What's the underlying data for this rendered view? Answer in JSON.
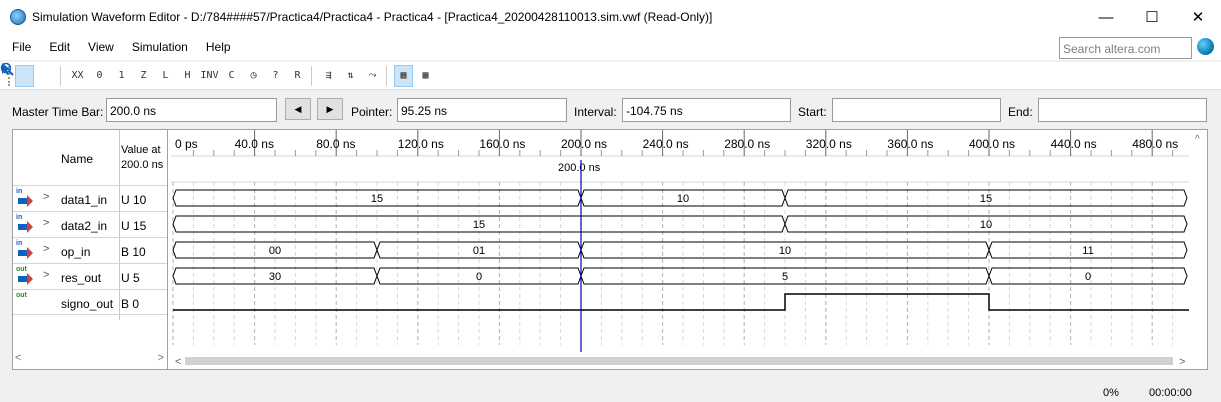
{
  "window": {
    "title": "Simulation Waveform Editor - D:/784####57/Practica4/Practica4 - Practica4 - [Practica4_20200428110013.sim.vwf (Read-Only)]",
    "minimize": "—",
    "maximize": "☐",
    "close": "✕"
  },
  "menu": [
    "File",
    "Edit",
    "View",
    "Simulation",
    "Help"
  ],
  "search": {
    "placeholder": "Search altera.com"
  },
  "toolbar": {
    "icons": [
      "selection-tool",
      "zoom-tool",
      "forcing-unknown",
      "forcing-low",
      "forcing-high",
      "high-impedance",
      "weak-low",
      "weak-high",
      "invert",
      "count-value",
      "clock",
      "arbitrary-value",
      "random-values",
      "snap-to-grid",
      "sort",
      "group",
      "overwrite-clock",
      "grid-display",
      "time-bar"
    ]
  },
  "timebar": {
    "master_label": "Master Time Bar:",
    "master_value": "200.0 ns",
    "prev": "◀",
    "next": "▶",
    "pointer_label": "Pointer:",
    "pointer_value": "95.25 ns",
    "interval_label": "Interval:",
    "interval_value": "-104.75 ns",
    "start_label": "Start:",
    "start_value": "",
    "end_label": "End:",
    "end_value": ""
  },
  "signals_header": {
    "name": "Name",
    "value_line1": "Value at",
    "value_line2": "200.0 ns"
  },
  "time_axis": {
    "labels": [
      "0 ps",
      "40.0 ns",
      "80.0 ns",
      "120.0 ns",
      "160.0 ns",
      "200.0 ns",
      "240.0 ns",
      "280.0 ns",
      "320.0 ns",
      "360.0 ns",
      "400.0 ns",
      "440.0 ns",
      "480.0 ns"
    ],
    "cursor_label": "200.0 ns",
    "cursor_time": 200
  },
  "signals": [
    {
      "name": "data1_in",
      "dir": "in",
      "value": "U 10",
      "type": "bus",
      "segments": [
        {
          "start": 0,
          "end": 200,
          "label": "15"
        },
        {
          "start": 200,
          "end": 300,
          "label": "10"
        },
        {
          "start": 300,
          "end": 500,
          "label": "15"
        }
      ]
    },
    {
      "name": "data2_in",
      "dir": "in",
      "value": "U 15",
      "type": "bus",
      "segments": [
        {
          "start": 0,
          "end": 300,
          "label": "15"
        },
        {
          "start": 300,
          "end": 500,
          "label": "10"
        }
      ]
    },
    {
      "name": "op_in",
      "dir": "in",
      "value": "B 10",
      "type": "bus",
      "segments": [
        {
          "start": 0,
          "end": 100,
          "label": "00"
        },
        {
          "start": 100,
          "end": 200,
          "label": "01"
        },
        {
          "start": 200,
          "end": 400,
          "label": "10"
        },
        {
          "start": 400,
          "end": 500,
          "label": "11"
        }
      ]
    },
    {
      "name": "res_out",
      "dir": "out",
      "value": "U 5",
      "type": "bus",
      "segments": [
        {
          "start": 0,
          "end": 100,
          "label": "30"
        },
        {
          "start": 100,
          "end": 200,
          "label": "0"
        },
        {
          "start": 200,
          "end": 400,
          "label": "5"
        },
        {
          "start": 400,
          "end": 500,
          "label": "0"
        }
      ]
    },
    {
      "name": "signo_out",
      "dir": "out",
      "value": "B 0",
      "type": "bit",
      "levels": [
        {
          "start": 0,
          "end": 300,
          "level": 0
        },
        {
          "start": 300,
          "end": 400,
          "level": 1
        },
        {
          "start": 400,
          "end": 500,
          "level": 0
        }
      ]
    }
  ],
  "status": {
    "progress": "0%",
    "elapsed": "00:00:00"
  },
  "colors": {
    "wave": "#000000",
    "cursor": "#0000c0",
    "grid": "#b0b0b0"
  }
}
